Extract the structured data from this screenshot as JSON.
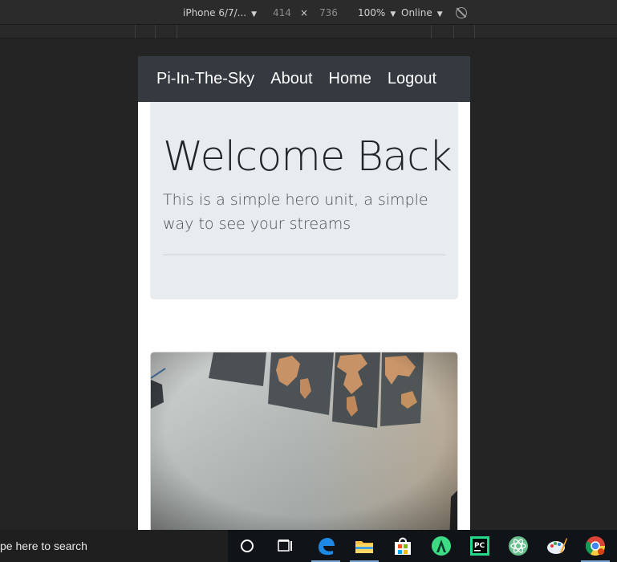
{
  "devtools": {
    "device": "iPhone 6/7/...",
    "width": "414",
    "times": "×",
    "height": "736",
    "zoom": "100%",
    "network": "Online"
  },
  "navbar": {
    "brand": "Pi-In-The-Sky",
    "links": [
      "About",
      "Home",
      "Logout"
    ]
  },
  "hero": {
    "title": "Welcome Back",
    "lead": "This is a simple hero unit, a simple way to see your streams"
  },
  "taskbar": {
    "search_placeholder": "pe here to search",
    "icons": [
      "cortana-icon",
      "task-view-icon",
      "edge-icon",
      "file-explorer-icon",
      "store-icon",
      "android-studio-icon",
      "pycharm-icon",
      "atom-icon",
      "paint-icon",
      "chrome-icon"
    ]
  },
  "colors": {
    "navbar_bg": "#343a40",
    "jumbotron_bg": "#e9ecef",
    "page_bg": "#242424"
  }
}
